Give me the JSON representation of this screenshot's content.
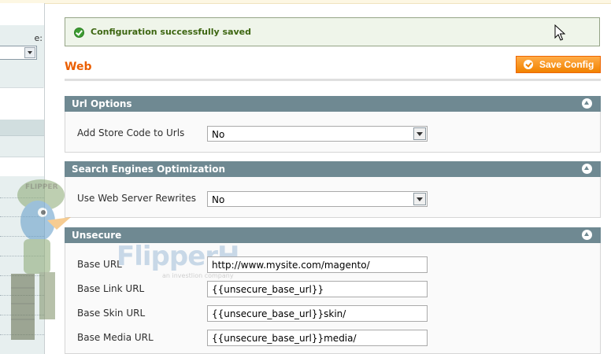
{
  "sidebar": {
    "scope_label": "e:"
  },
  "message": {
    "text": "Configuration successfully saved"
  },
  "header": {
    "title": "Web",
    "save_label": "Save Config"
  },
  "sections": {
    "url_options": {
      "title": "Url Options",
      "add_store_code_label": "Add Store Code to Urls",
      "add_store_code_value": "No"
    },
    "seo": {
      "title": "Search Engines Optimization",
      "rewrites_label": "Use Web Server Rewrites",
      "rewrites_value": "No"
    },
    "unsecure": {
      "title": "Unsecure",
      "base_url_label": "Base URL",
      "base_url_value": "http://www.mysite.com/magento/",
      "base_link_url_label": "Base Link URL",
      "base_link_url_value": "{{unsecure_base_url}}",
      "base_skin_url_label": "Base Skin URL",
      "base_skin_url_value": "{{unsecure_base_url}}skin/",
      "base_media_url_label": "Base Media URL",
      "base_media_url_value": "{{unsecure_base_url}}media/"
    }
  },
  "watermark": {
    "mascot_text": "FLIPPER",
    "brand": "FlipperH",
    "tagline": "an investlion company"
  },
  "colors": {
    "accent": "#eb5e00",
    "section_header": "#6f8992",
    "success_bg": "#eff5ea",
    "success_text": "#3d6611"
  }
}
